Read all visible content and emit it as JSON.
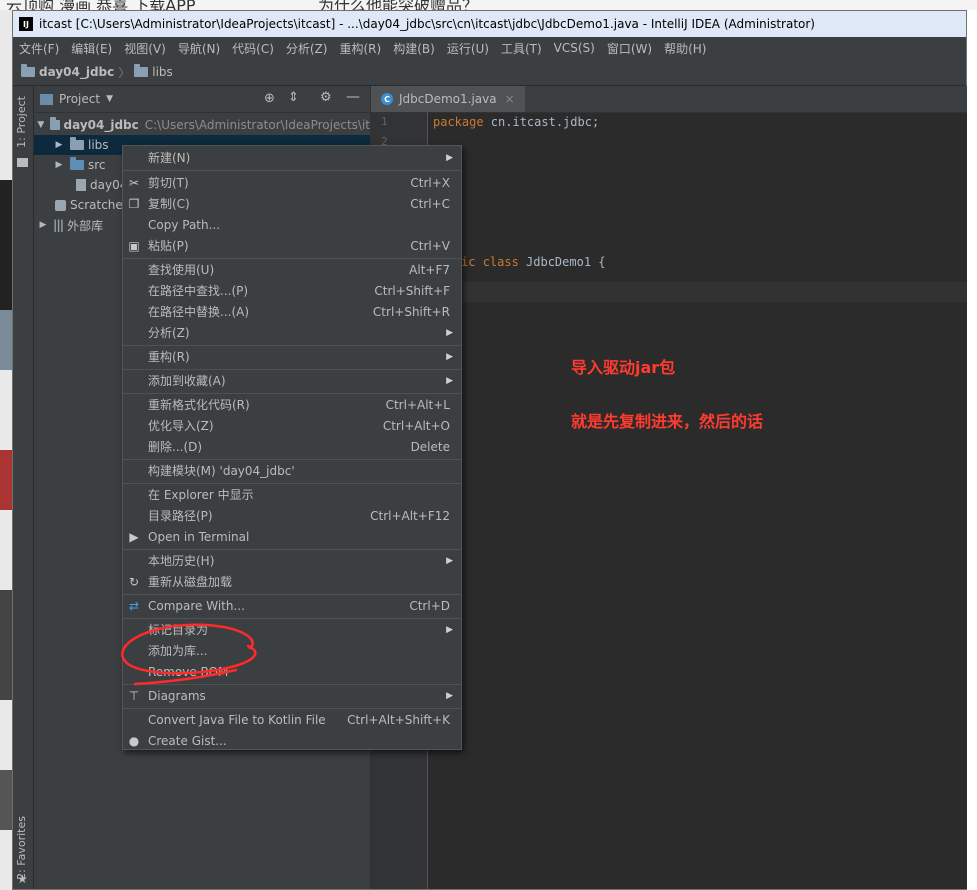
{
  "background": {
    "browser_text": "云顶购  漫画  恭喜  下载APP",
    "browser_text_2": "为什么他能突破赠品？"
  },
  "window": {
    "title": "itcast [C:\\Users\\Administrator\\IdeaProjects\\itcast] - ...\\day04_jdbc\\src\\cn\\itcast\\jdbc\\JdbcDemo1.java - IntelliJ IDEA (Administrator)"
  },
  "menubar": [
    "文件(F)",
    "编辑(E)",
    "视图(V)",
    "导航(N)",
    "代码(C)",
    "分析(Z)",
    "重构(R)",
    "构建(B)",
    "运行(U)",
    "工具(T)",
    "VCS(S)",
    "窗口(W)",
    "帮助(H)"
  ],
  "breadcrumb": [
    "day04_jdbc",
    "libs"
  ],
  "toolstrip": {
    "project_tab": "1: Project",
    "favorites_tab": "2: Favorites"
  },
  "project": {
    "header": "Project",
    "tree": [
      {
        "label": "day04_jdbc",
        "path": "C:\\Users\\Administrator\\IdeaProjects\\it"
      },
      {
        "label": "libs"
      },
      {
        "label": "src"
      },
      {
        "label": "day04"
      },
      {
        "label": "Scratche"
      },
      {
        "label": "外部库"
      }
    ]
  },
  "editor": {
    "tab": "JdbcDemo1.java",
    "lines": [
      "1",
      "2"
    ],
    "code": {
      "line1_kw": "package",
      "line1_rest": " cn.itcast.jdbc;",
      "line_class_prefix": "ic",
      "line_class_kw": "class",
      "line_class_name": " JdbcDemo1 {"
    }
  },
  "annotations": {
    "a1": "导入驱动jar包",
    "a2": "就是先复制进来，然后的话"
  },
  "context_menu": [
    {
      "label": "新建(N)",
      "shortcut": "",
      "submenu": true
    },
    {
      "label": "剪切(T)",
      "shortcut": "Ctrl+X",
      "icon": "cut-icon"
    },
    {
      "label": "复制(C)",
      "shortcut": "Ctrl+C",
      "icon": "copy-icon"
    },
    {
      "label": "Copy Path...",
      "shortcut": ""
    },
    {
      "label": "粘贴(P)",
      "shortcut": "Ctrl+V",
      "icon": "paste-icon"
    },
    {
      "label": "查找使用(U)",
      "shortcut": "Alt+F7"
    },
    {
      "label": "在路径中查找...(P)",
      "shortcut": "Ctrl+Shift+F"
    },
    {
      "label": "在路径中替换...(A)",
      "shortcut": "Ctrl+Shift+R"
    },
    {
      "label": "分析(Z)",
      "shortcut": "",
      "submenu": true
    },
    {
      "label": "重构(R)",
      "shortcut": "",
      "submenu": true
    },
    {
      "label": "添加到收藏(A)",
      "shortcut": "",
      "submenu": true
    },
    {
      "label": "重新格式化代码(R)",
      "shortcut": "Ctrl+Alt+L"
    },
    {
      "label": "优化导入(Z)",
      "shortcut": "Ctrl+Alt+O"
    },
    {
      "label": "删除...(D)",
      "shortcut": "Delete"
    },
    {
      "label": "构建模块(M) 'day04_jdbc'",
      "shortcut": ""
    },
    {
      "label": "在 Explorer 中显示",
      "shortcut": ""
    },
    {
      "label": "目录路径(P)",
      "shortcut": "Ctrl+Alt+F12"
    },
    {
      "label": "Open in Terminal",
      "shortcut": "",
      "icon": "terminal-icon"
    },
    {
      "label": "本地历史(H)",
      "shortcut": "",
      "submenu": true
    },
    {
      "label": "重新从磁盘加载",
      "shortcut": "",
      "icon": "reload-icon"
    },
    {
      "label": "Compare With...",
      "shortcut": "Ctrl+D",
      "icon": "compare-icon"
    },
    {
      "label": "标记目录为",
      "shortcut": "",
      "submenu": true
    },
    {
      "label": "添加为库...",
      "shortcut": ""
    },
    {
      "label": "Remove BOM",
      "shortcut": ""
    },
    {
      "label": "Diagrams",
      "shortcut": "",
      "submenu": true,
      "icon": "diagram-icon"
    },
    {
      "label": "Convert Java File to Kotlin File",
      "shortcut": "Ctrl+Alt+Shift+K"
    },
    {
      "label": "Create Gist...",
      "shortcut": "",
      "icon": "github-icon"
    }
  ],
  "colors": {
    "annotation": "#ff3b30",
    "keyword": "#cc7832",
    "selection": "#0d293e"
  }
}
